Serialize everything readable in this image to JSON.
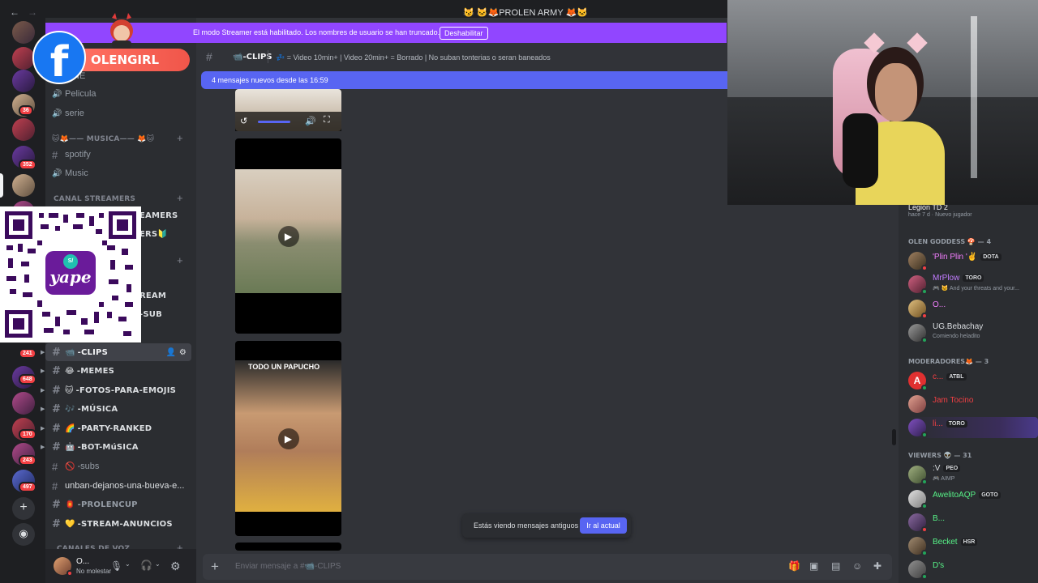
{
  "window": {
    "title": "😼 🐱🦊PROLEN ARMY 🦊🐱",
    "back": "←",
    "forward": "→"
  },
  "streamer_mode": {
    "message": "El modo Streamer está habilitado. Los nombres de usuario se han truncado.",
    "disable_label": "Deshabilitar"
  },
  "overlay": {
    "fb_letter": "f",
    "fb_name": "OLENGIRL",
    "yape_label": "yape",
    "yape_symbol": "S/"
  },
  "rail": {
    "badges": [
      "36",
      "352",
      "241",
      "648",
      "170",
      "243",
      "497"
    ],
    "add_icon": "plus-icon",
    "discover_icon": "compass-icon"
  },
  "sidebar": {
    "truncated_top": "NE",
    "voice_channels_top": [
      "Pelicula",
      "serie"
    ],
    "music_category": "🐱🦊—— MUSICA—— 🦊🐱",
    "music_channels": [
      "spotify",
      "Music"
    ],
    "streamers_category": "CANAL STREAMERS",
    "partial_channels": [
      "EAMERS",
      "ERS🔰",
      "REAM",
      "-SUB"
    ],
    "text_channels": [
      {
        "emoji": "📹",
        "label": "-CLIPS",
        "bold": true
      },
      {
        "emoji": "😂",
        "label": "-MEMES",
        "bold": true
      },
      {
        "emoji": "🐱",
        "label": "-FOTOS-PARA-EMOJIS",
        "bold": true
      },
      {
        "emoji": "🎶",
        "label": "-MÚSICA",
        "bold": true
      },
      {
        "emoji": "🌈",
        "label": "-PARTY-RANKED",
        "bold": true
      },
      {
        "emoji": "🤖",
        "label": "-BOT-MúSICA",
        "bold": true
      },
      {
        "emoji": "🚫",
        "label": "-subs",
        "bold": false
      },
      {
        "emoji": "",
        "label": "unban-dejanos-una-bueva-e...",
        "bold": false
      },
      {
        "emoji": "🏮",
        "label": "-PROLENCUP",
        "bold": true
      },
      {
        "emoji": "💛",
        "label": "-STREAM-ANUNCIOS",
        "bold": true
      }
    ],
    "voice_category": "CANALES DE VOZ",
    "user": {
      "name": "O...",
      "status": "No molestar"
    }
  },
  "channel": {
    "name": "📹-CLIPS",
    "topic": "💤 = Video 10min+ | Video 20min+ = Borrado | No suban tonterias o seran baneados",
    "new_messages": "4 mensajes nuevos desde las 16:59",
    "old_messages_text": "Estás viendo mensajes antiguos",
    "jump_label": "Ir al actual",
    "composer_placeholder": "Enviar mensaje a #📹-CLIPS",
    "video2_caption": "TODO UN PAPUCHO"
  },
  "members": {
    "top_entry": {
      "name": "Legion TD 2",
      "sub": "hace 7 d · Nuevo jugador"
    },
    "groups": [
      {
        "title": "OLEN GODDESS 🍄 — 4",
        "members": [
          {
            "name": "'Plin Plin '✌",
            "color": "#f47fff",
            "tag": "DOTA",
            "sub": ""
          },
          {
            "name": "MrPlow",
            "color": "#c27cff",
            "tag": "TORO",
            "sub": "🎮 🐱 And your threats and your..."
          },
          {
            "name": "O...",
            "color": "#f47fff",
            "tag": "",
            "sub": ""
          },
          {
            "name": "UG.Bebachay",
            "color": "#c27cff",
            "tag": "",
            "sub": "Comiendo heladito"
          }
        ]
      },
      {
        "title": "MODERADORES🦊 — 3",
        "members": [
          {
            "name": "c...",
            "color": "#f23f43",
            "tag": "ATBL",
            "sub": ""
          },
          {
            "name": "Jam Tocino",
            "color": "#f23f43",
            "tag": "",
            "sub": ""
          },
          {
            "name": "li...",
            "color": "#f23f43",
            "tag": "TORO",
            "sub": ""
          }
        ]
      },
      {
        "title": "VIEWERS 👽 — 31",
        "members": [
          {
            "name": ":V",
            "color": "#f2f3f5",
            "tag": "PEO",
            "sub": "🎮 AIMP"
          },
          {
            "name": "AwelitoAQP",
            "color": "#57f287",
            "tag": "GOTO",
            "sub": ""
          },
          {
            "name": "B...",
            "color": "#57f287",
            "tag": "",
            "sub": ""
          },
          {
            "name": "Becket",
            "color": "#57f287",
            "tag": "HSR",
            "sub": ""
          },
          {
            "name": "D's",
            "color": "#57f287",
            "tag": "",
            "sub": ""
          }
        ]
      }
    ]
  },
  "colors": {
    "streamer_purple": "#9146ff",
    "blurple": "#5865f2",
    "facebook": "#1877f2",
    "yape": "#6a1b9a"
  }
}
